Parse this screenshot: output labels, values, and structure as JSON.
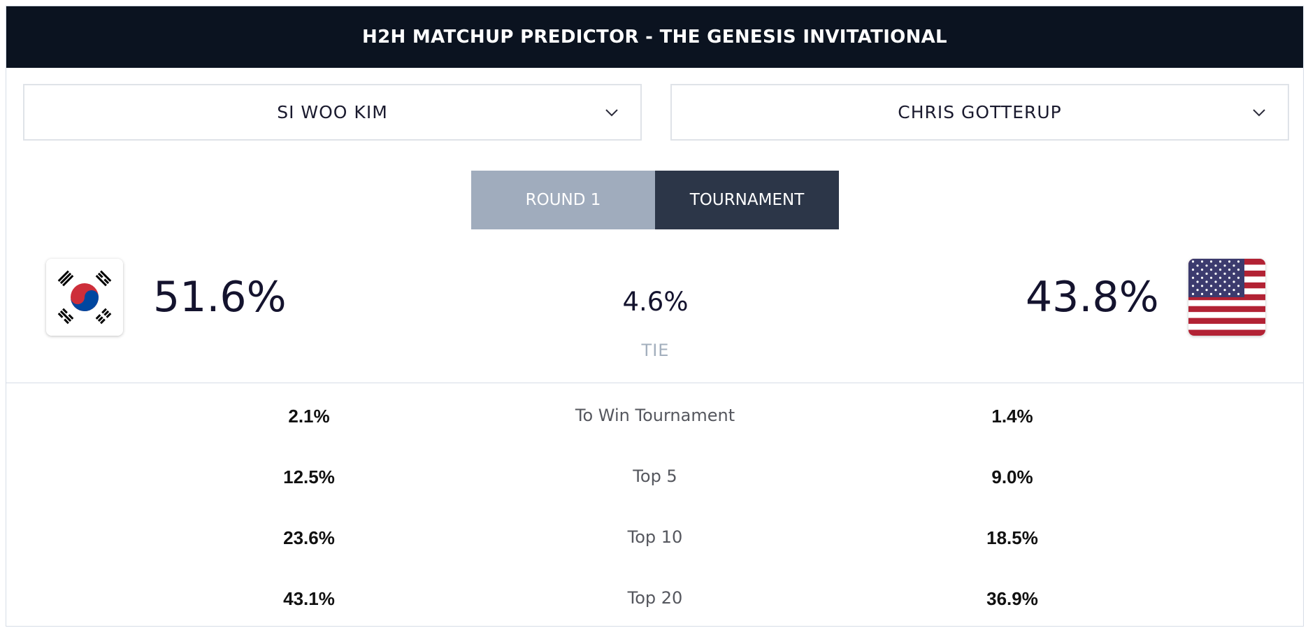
{
  "header": {
    "title": "H2H MATCHUP PREDICTOR - THE GENESIS INVITATIONAL"
  },
  "players": {
    "left": {
      "name": "SI WOO KIM",
      "flag": "south-korea-flag",
      "win_pct": "51.6%"
    },
    "right": {
      "name": "CHRIS GOTTERUP",
      "flag": "usa-flag",
      "win_pct": "43.8%"
    }
  },
  "toggle": {
    "round_label": "ROUND 1",
    "tournament_label": "TOURNAMENT",
    "active": "tournament"
  },
  "tie": {
    "value": "4.6%",
    "label": "TIE"
  },
  "stats": [
    {
      "label": "To Win Tournament",
      "left": "2.1%",
      "right": "1.4%"
    },
    {
      "label": "Top 5",
      "left": "12.5%",
      "right": "9.0%"
    },
    {
      "label": "Top 10",
      "left": "23.6%",
      "right": "18.5%"
    },
    {
      "label": "Top 20",
      "left": "43.1%",
      "right": "36.9%"
    }
  ],
  "colors": {
    "header_bg": "#0b1320",
    "toggle_inactive": "#a0acbd",
    "toggle_active": "#2c3648",
    "tie_label": "#a3afbd"
  }
}
